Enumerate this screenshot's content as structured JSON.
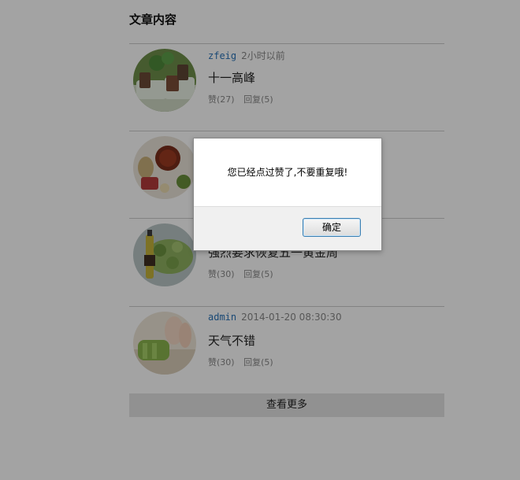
{
  "section_title": "文章内容",
  "posts": [
    {
      "author": "zfeig",
      "time": "2小时以前",
      "title": "十一高峰",
      "like_label": "赞(27)",
      "reply_label": "回复(5)",
      "image_icon": "food-cups-image"
    },
    {
      "author": "",
      "time": "",
      "title": "",
      "like_label": "",
      "reply_label": "",
      "image_icon": "food-bowls-image"
    },
    {
      "author": "",
      "time": "",
      "title": "强烈要求恢复五一黄金周",
      "like_label": "赞(30)",
      "reply_label": "回复(5)",
      "image_icon": "salad-bottle-image"
    },
    {
      "author": "admin",
      "time": "2014-01-20 08:30:30",
      "title": "天气不错",
      "like_label": "赞(30)",
      "reply_label": "回复(5)",
      "image_icon": "chopping-greens-image"
    }
  ],
  "more_button": "查看更多",
  "dialog": {
    "message": "您已经点过赞了,不要重复哦!",
    "ok_label": "确定"
  }
}
